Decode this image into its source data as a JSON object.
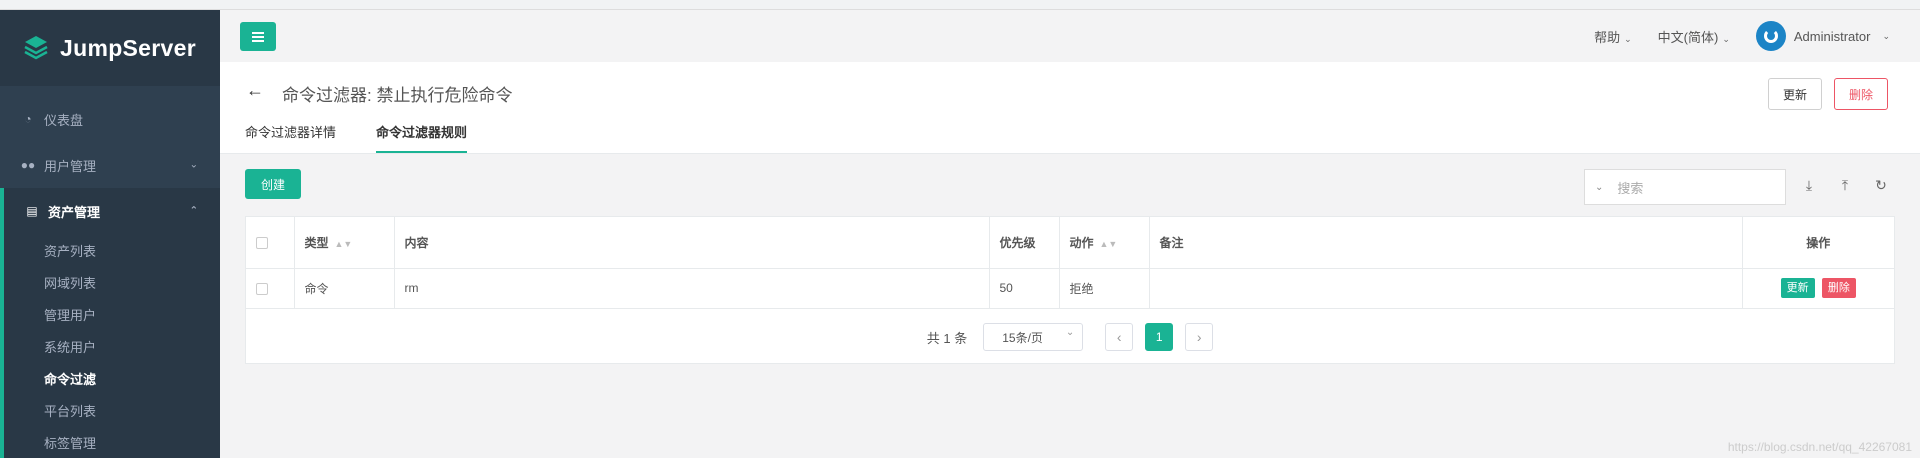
{
  "sidebar": {
    "brand": "JumpServer",
    "items": [
      {
        "label": "仪表盘",
        "icon": "dashboard-icon"
      },
      {
        "label": "用户管理",
        "icon": "users-icon"
      },
      {
        "label": "资产管理",
        "icon": "inbox-icon"
      }
    ],
    "submenu": [
      {
        "label": "资产列表"
      },
      {
        "label": "网域列表"
      },
      {
        "label": "管理用户"
      },
      {
        "label": "系统用户"
      },
      {
        "label": "命令过滤"
      },
      {
        "label": "平台列表"
      },
      {
        "label": "标签管理"
      }
    ]
  },
  "topbar": {
    "help": "帮助",
    "language": "中文(简体)",
    "user": "Administrator"
  },
  "page": {
    "title": "命令过滤器: 禁止执行危险命令",
    "update_label": "更新",
    "delete_label": "删除",
    "tabs": [
      {
        "label": "命令过滤器详情"
      },
      {
        "label": "命令过滤器规则"
      }
    ]
  },
  "toolbar": {
    "create_label": "创建",
    "search_placeholder": "搜索"
  },
  "table": {
    "columns": [
      "类型",
      "内容",
      "优先级",
      "动作",
      "备注",
      "操作"
    ],
    "rows": [
      {
        "type": "命令",
        "content": "rm",
        "priority": "50",
        "action": "拒绝",
        "note": "",
        "update": "更新",
        "delete": "删除"
      }
    ]
  },
  "pagination": {
    "total": "共 1 条",
    "page_size": "15条/页",
    "current_page": "1"
  },
  "watermark": "https://blog.csdn.net/qq_42267081",
  "colors": {
    "accent": "#1ab394",
    "danger": "#ed5565",
    "sidebar": "#2f4050"
  }
}
